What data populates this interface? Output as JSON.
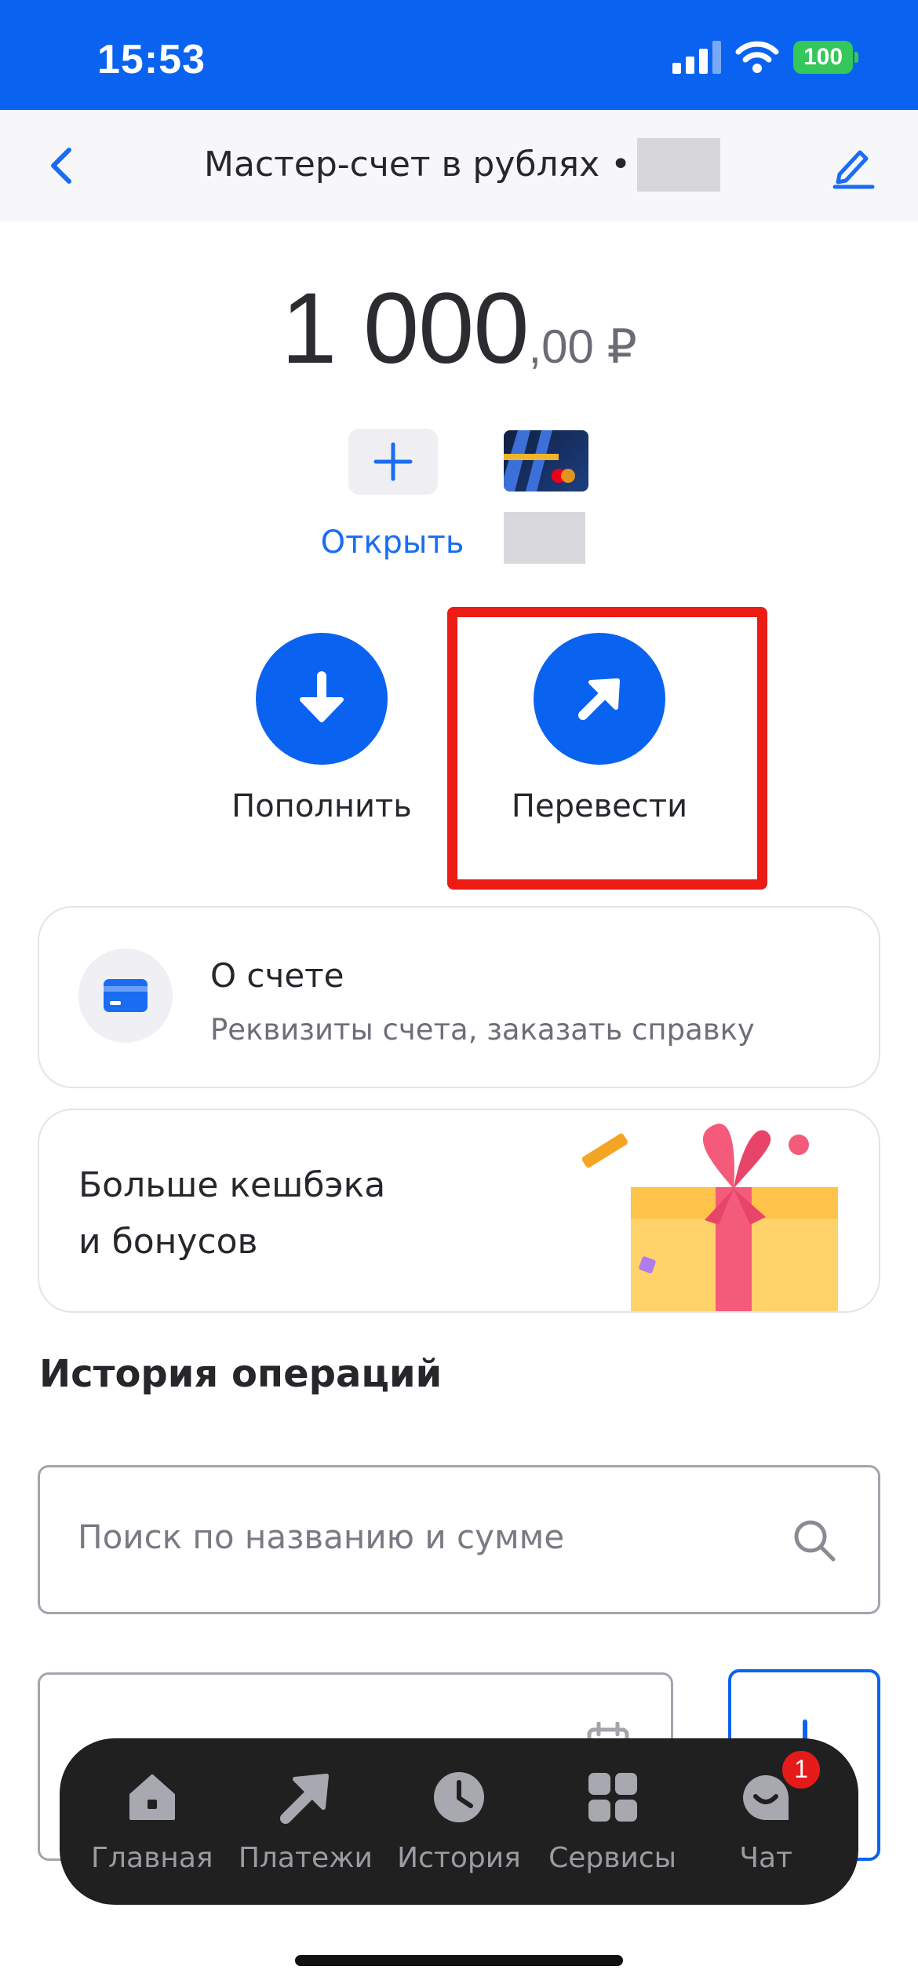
{
  "status_bar": {
    "time": "15:53",
    "battery": "100"
  },
  "header": {
    "title": "Мастер-счет в рублях •"
  },
  "balance": {
    "integer": "1 000",
    "fraction": ",00 ₽"
  },
  "cards": {
    "open_label": "Открыть"
  },
  "actions": {
    "topup_label": "Пополнить",
    "transfer_label": "Перевести"
  },
  "about_tile": {
    "title": "О счете",
    "subtitle": "Реквизиты счета, заказать справку"
  },
  "promo_tile": {
    "line1": "Больше кешбэка",
    "line2": "и бонусов"
  },
  "history": {
    "title": "История операций",
    "search_placeholder": "Поиск по названию и сумме"
  },
  "tab_bar": {
    "items": [
      {
        "label": "Главная",
        "icon": "home-icon"
      },
      {
        "label": "Платежи",
        "icon": "arrow-up-right-icon"
      },
      {
        "label": "История",
        "icon": "clock-icon"
      },
      {
        "label": "Сервисы",
        "icon": "grid-icon"
      },
      {
        "label": "Чат",
        "icon": "chat-icon"
      }
    ],
    "chat_badge": "1"
  },
  "colors": {
    "accent": "#0a63f0",
    "highlight": "#ea1c14",
    "tab_bar_bg": "#202020"
  }
}
